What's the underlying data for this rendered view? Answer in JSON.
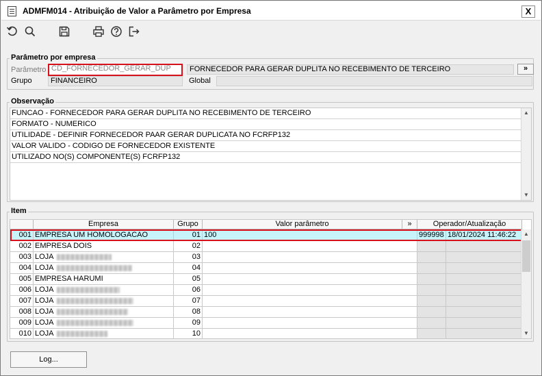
{
  "window": {
    "title": "ADMFM014 - Atribuição de Valor a Parâmetro por Empresa",
    "close_glyph": "X"
  },
  "toolbar": {
    "buttons": [
      {
        "icon": "undo-icon"
      },
      {
        "icon": "search-icon"
      },
      {
        "icon": "save-icon"
      },
      {
        "icon": "print-icon"
      },
      {
        "icon": "help-icon"
      },
      {
        "icon": "exit-icon"
      }
    ]
  },
  "parametro": {
    "legend": "Parâmetro por empresa",
    "parametro_label": "Parâmetro",
    "parametro_value": "CD_FORNECEDOR_GERAR_DUP",
    "descricao_value": "FORNECEDOR PARA GERAR DUPLITA NO RECEBIMENTO DE TERCEIRO",
    "more_glyph": "»",
    "grupo_label": "Grupo",
    "grupo_value": "FINANCEIRO",
    "global_label": "Global",
    "global_value": ""
  },
  "observacao": {
    "legend": "Observação",
    "lines": [
      "FUNCAO - FORNECEDOR PARA GERAR DUPLITA NO RECEBIMENTO DE TERCEIRO",
      "FORMATO - NUMERICO",
      "UTILIDADE - DEFINIR FORNECEDOR PAAR GERAR DUPLICATA NO FCRFP132",
      "VALOR VALIDO - CODIGO DE FORNECEDOR EXISTENTE",
      "UTILIZADO NO(S) COMPONENTE(S) FCRFP132"
    ]
  },
  "item": {
    "legend": "Item",
    "headers": {
      "empresa": "Empresa",
      "grupo": "Grupo",
      "valor": "Valor parâmetro",
      "more": "»",
      "operador": "Operador/Atualização"
    },
    "rows": [
      {
        "codigo": "001",
        "empresa": "EMPRESA UM HOMOLOGACAO",
        "grupo": "01",
        "valor": "100",
        "operador": "999998",
        "atualizacao": "18/01/2024 11:46:22",
        "selected": true
      },
      {
        "codigo": "002",
        "empresa": "EMPRESA DOIS",
        "grupo": "02",
        "valor": "",
        "operador": "",
        "atualizacao": ""
      },
      {
        "codigo": "003",
        "empresa": "LOJA",
        "grupo": "03",
        "valor": "",
        "operador": "",
        "atualizacao": "",
        "redacted": 80
      },
      {
        "codigo": "004",
        "empresa": "LOJA",
        "grupo": "04",
        "valor": "",
        "operador": "",
        "atualizacao": "",
        "redacted": 110
      },
      {
        "codigo": "005",
        "empresa": "EMPRESA HARUMI",
        "grupo": "05",
        "valor": "",
        "operador": "",
        "atualizacao": ""
      },
      {
        "codigo": "006",
        "empresa": "LOJA",
        "grupo": "06",
        "valor": "",
        "operador": "",
        "atualizacao": "",
        "redacted": 92
      },
      {
        "codigo": "007",
        "empresa": "LOJA",
        "grupo": "07",
        "valor": "",
        "operador": "",
        "atualizacao": "",
        "redacted": 112
      },
      {
        "codigo": "008",
        "empresa": "LOJA",
        "grupo": "08",
        "valor": "",
        "operador": "",
        "atualizacao": "",
        "redacted": 104
      },
      {
        "codigo": "009",
        "empresa": "LOJA",
        "grupo": "09",
        "valor": "",
        "operador": "",
        "atualizacao": "",
        "redacted": 112
      },
      {
        "codigo": "010",
        "empresa": "LOJA",
        "grupo": "10",
        "valor": "",
        "operador": "",
        "atualizacao": "",
        "redacted": 74
      }
    ]
  },
  "footer": {
    "log_label": "Log..."
  },
  "colors": {
    "highlight_border": "#d8101c",
    "selected_row": "#c7f3fb"
  }
}
